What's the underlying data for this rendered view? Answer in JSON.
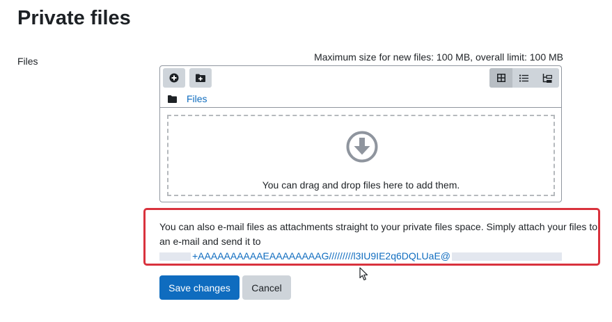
{
  "page": {
    "title": "Private files"
  },
  "form": {
    "field_label": "Files",
    "limits": "Maximum size for new files: 100 MB, overall limit: 100 MB"
  },
  "filemanager": {
    "toolbar": {
      "add_icon": "plus-circle-icon",
      "folder_icon": "folder-plus-icon"
    },
    "views": [
      {
        "icon": "grid-icon",
        "active": true
      },
      {
        "icon": "list-icon",
        "active": false
      },
      {
        "icon": "tree-icon",
        "active": false
      }
    ],
    "path_label": "Files",
    "drop_text": "You can drag and drop files here to add them."
  },
  "notice": {
    "text": "You can also e-mail files as attachments straight to your private files space. Simply attach your files to an e-mail and send it to",
    "email_visible": "+AAAAAAAAAAEAAAAAAAAG/////////l3IU9IE2q6DQLUaE@"
  },
  "buttons": {
    "save": "Save changes",
    "cancel": "Cancel"
  },
  "colors": {
    "primary": "#0f6cbf",
    "secondary": "#ced4da",
    "highlight_border": "#d9323d"
  }
}
